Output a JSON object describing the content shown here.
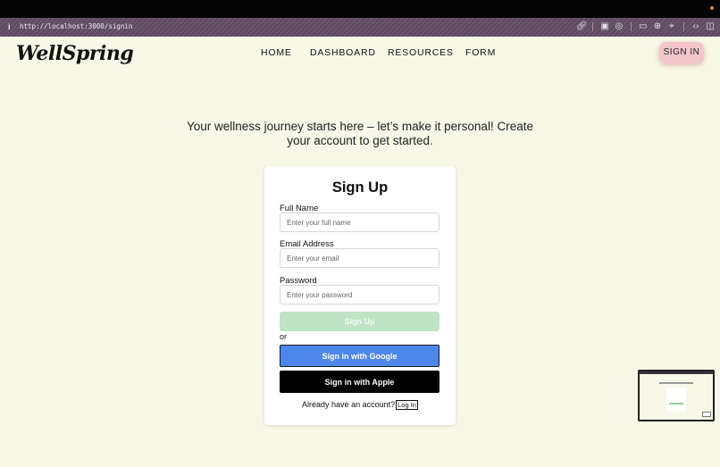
{
  "browser": {
    "info_icon": "info-icon",
    "url": "http://localhost:3000/signin",
    "toolbar_icons": [
      "link-icon",
      "screenshot-icon",
      "camera-icon",
      "window-icon",
      "globe-icon",
      "crosshair-icon",
      "code-icon",
      "sidebar-icon"
    ]
  },
  "header": {
    "logo": "WellSpring",
    "nav": [
      "HOME",
      "DASHBOARD",
      "RESOURCES",
      "FORM"
    ],
    "signin_label": "SIGN IN"
  },
  "intro": "Your wellness journey starts here – let’s make it personal! Create your account to get started.",
  "form": {
    "title": "Sign Up",
    "fields": [
      {
        "label": "Full Name",
        "placeholder": "Enter your full name"
      },
      {
        "label": "Email Address",
        "placeholder": "Enter your email"
      },
      {
        "label": "Password",
        "placeholder": "Enter your password"
      }
    ],
    "submit_label": "Sign Up",
    "or_text": "or",
    "google_label": "Sign in with Google",
    "apple_label": "Sign in with Apple",
    "already_text": "Already have an account?",
    "login_label": "Log In"
  },
  "colors": {
    "page_bg": "#f7f8e8",
    "signin_btn": "#f4c6cc",
    "signup_btn": "#bfe3c5",
    "google_btn": "#4f86ec",
    "apple_btn": "#000000"
  }
}
